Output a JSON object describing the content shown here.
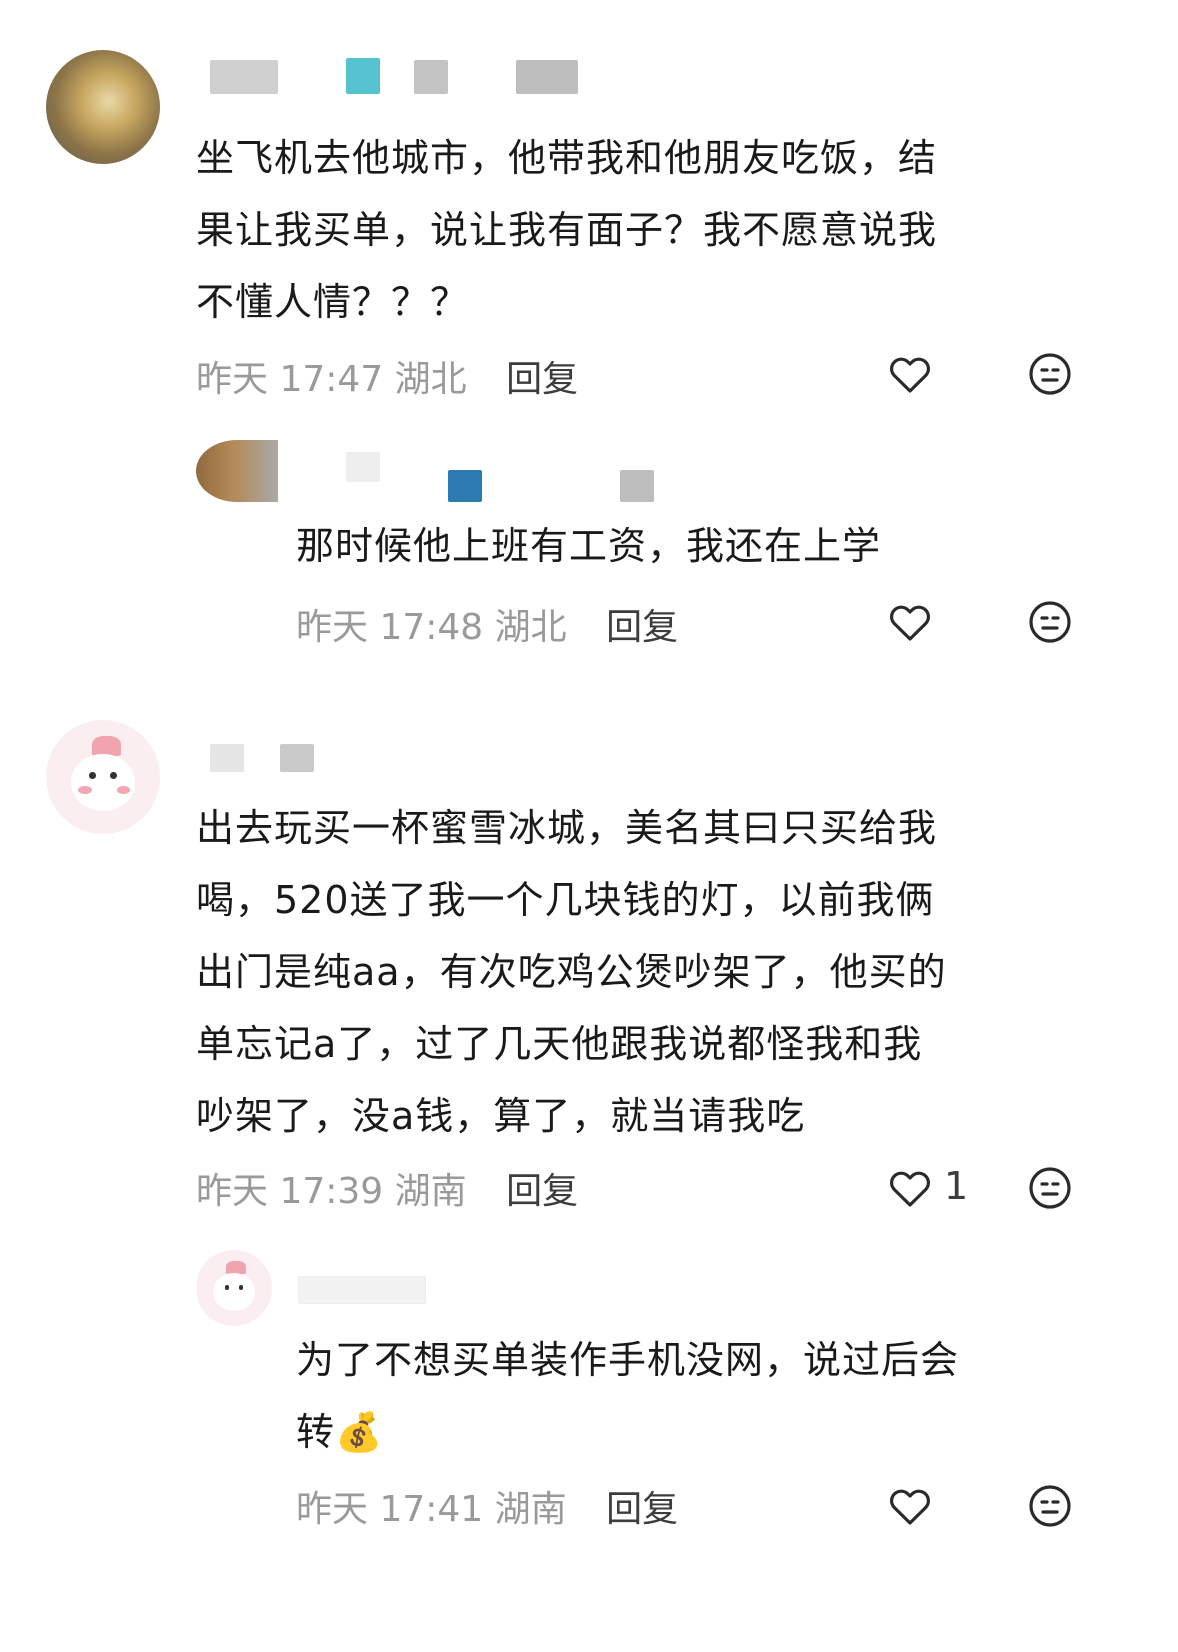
{
  "comments": [
    {
      "text": "坐飞机去他城市，他带我和他朋友吃饭，结\n果让我买单，说让我有面子？我不愿意说我\n不懂人情？？？",
      "time": "昨天 17:47",
      "location": "湖北",
      "reply_label": "回复",
      "like_count": "",
      "reply": {
        "text": "那时候他上班有工资，我还在上学",
        "time": "昨天 17:48",
        "location": "湖北",
        "reply_label": "回复"
      }
    },
    {
      "text": "出去玩买一杯蜜雪冰城，美名其曰只买给我\n喝，520送了我一个几块钱的灯，以前我俩\n出门是纯aa，有次吃鸡公煲吵架了，他买的\n单忘记a了，过了几天他跟我说都怪我和我\n吵架了，没a钱，算了，就当请我吃",
      "time": "昨天 17:39",
      "location": "湖南",
      "reply_label": "回复",
      "like_count": "1",
      "reply": {
        "text": "为了不想买单装作手机没网，说过后会\n转💰",
        "time": "昨天 17:41",
        "location": "湖南",
        "reply_label": "回复"
      }
    }
  ],
  "icons": {
    "like": "heart-outline-icon",
    "dislike": "neutral-face-icon",
    "avatar_1": "mountain-avatar",
    "avatar_2": "cute-character-avatar"
  }
}
